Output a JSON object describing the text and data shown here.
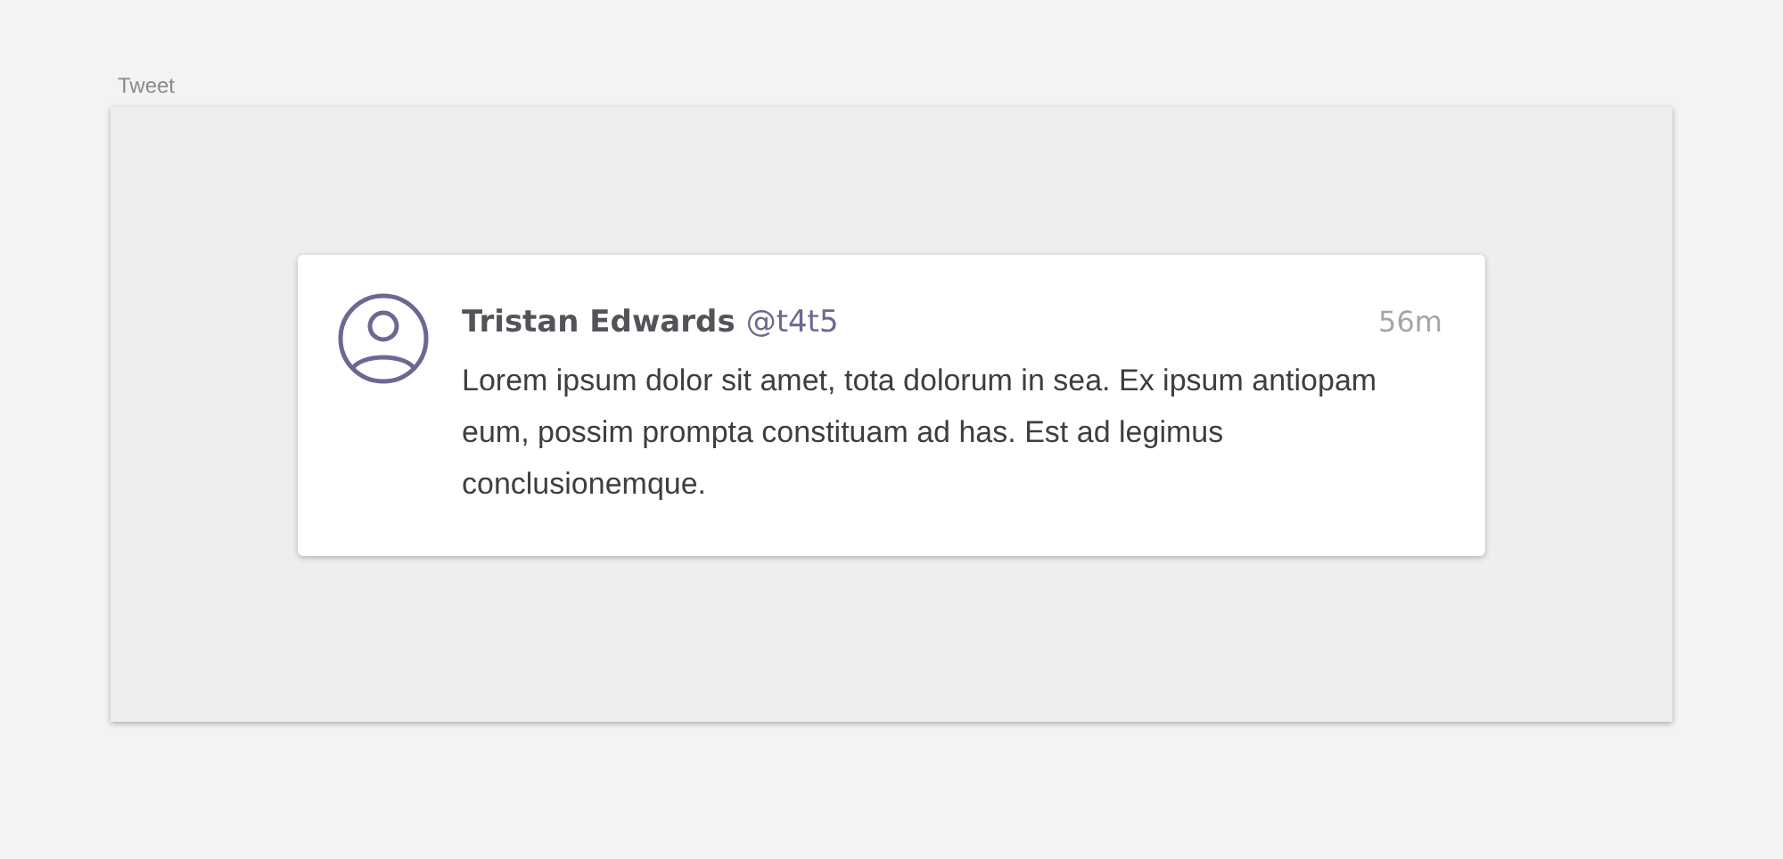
{
  "frame": {
    "title": "Tweet"
  },
  "tweet": {
    "name": "Tristan Edwards",
    "handle": "@t4t5",
    "time": "56m",
    "text": "Lorem ipsum dolor sit amet, tota dolorum in sea. Ex ipsum antiopam eum, possim prompta constituam ad has. Est ad legimus conclusionemque."
  }
}
